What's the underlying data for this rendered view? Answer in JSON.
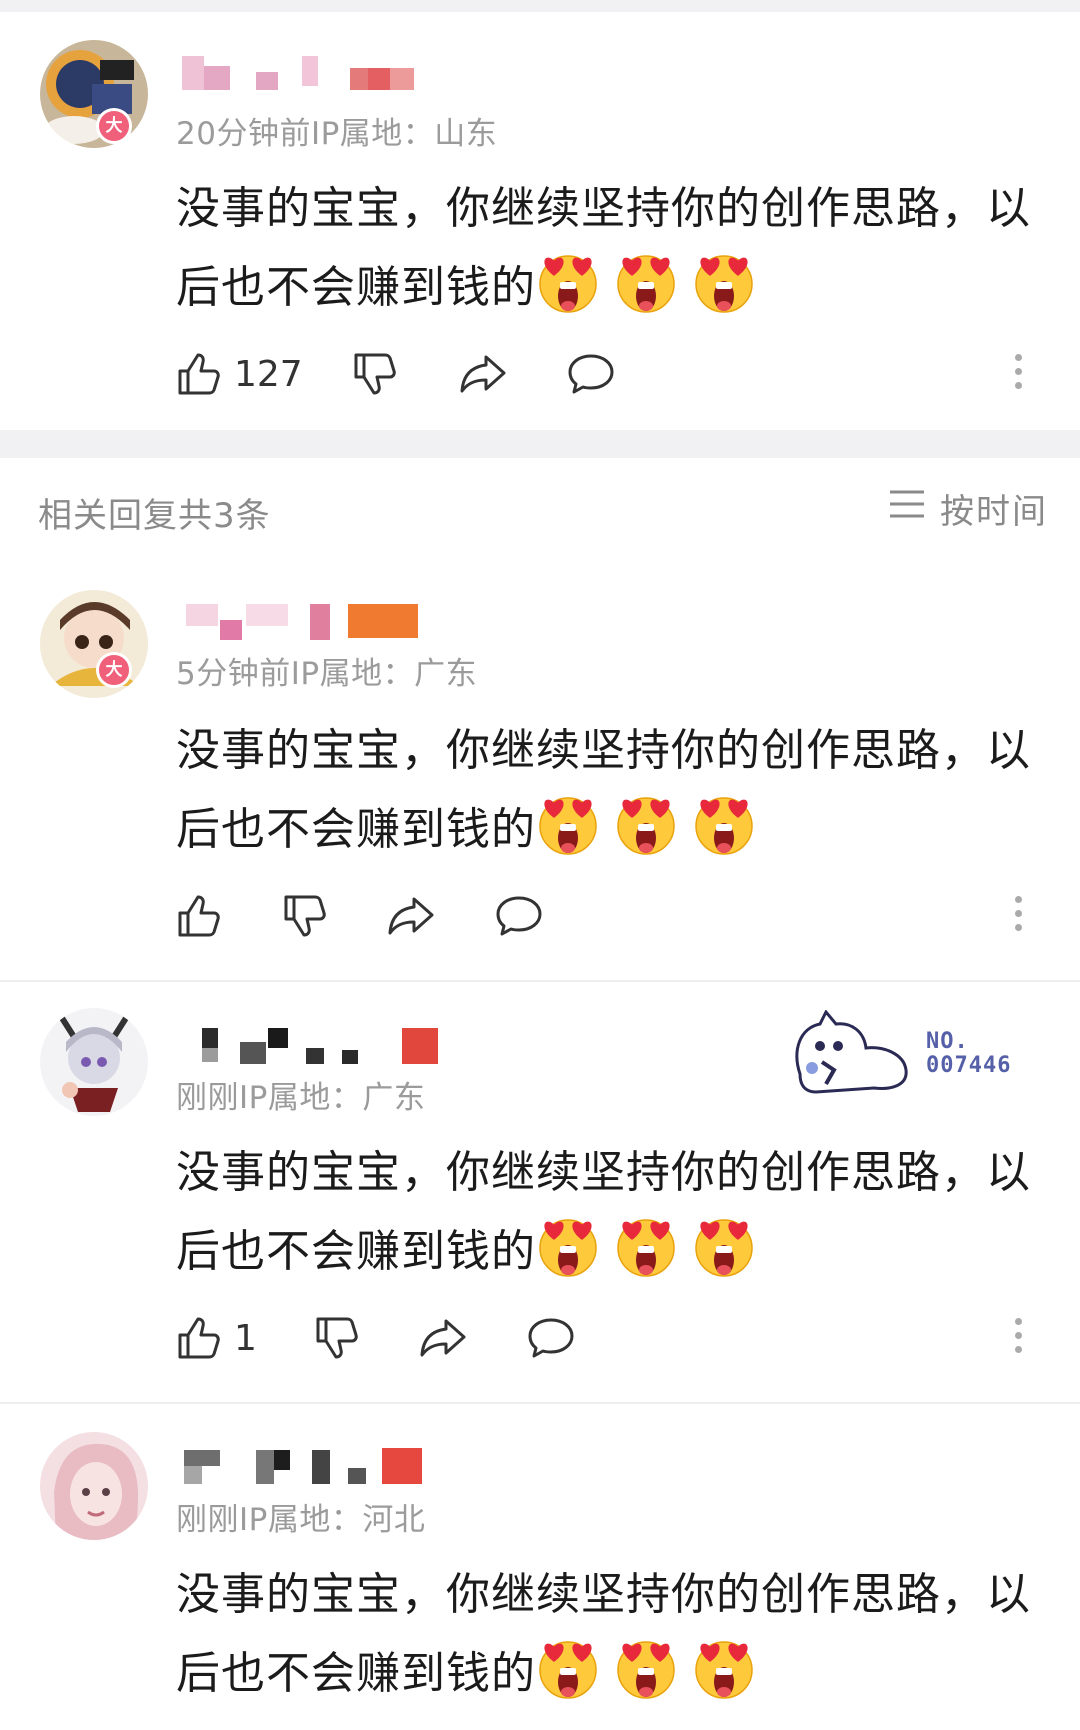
{
  "comments": [
    {
      "id": "main",
      "time": "20分钟前",
      "ip_label": "IP属地：",
      "ip": "山东",
      "text": "没事的宝宝，你继续坚持你的创作思路，以后也不会赚到钱的",
      "emoji": [
        "heart-eyes-emoji",
        "heart-eyes-emoji",
        "heart-eyes-emoji"
      ],
      "likes": "127",
      "avatar_badge": "大"
    },
    {
      "id": "reply1",
      "time": "5分钟前",
      "ip_label": "IP属地：",
      "ip": "广东",
      "text": "没事的宝宝，你继续坚持你的创作思路，以后也不会赚到钱的",
      "emoji": [
        "heart-eyes-emoji",
        "heart-eyes-emoji",
        "heart-eyes-emoji"
      ],
      "likes": "",
      "avatar_badge": "大"
    },
    {
      "id": "reply2",
      "time": "刚刚",
      "ip_label": "IP属地：",
      "ip": "广东",
      "text": "没事的宝宝，你继续坚持你的创作思路，以后也不会赚到钱的",
      "emoji": [
        "heart-eyes-emoji",
        "heart-eyes-emoji",
        "heart-eyes-emoji"
      ],
      "likes": "1",
      "decoration_badge": {
        "label": "NO.",
        "number": "007446"
      }
    },
    {
      "id": "reply3",
      "time": "刚刚",
      "ip_label": "IP属地：",
      "ip": "河北",
      "text": "没事的宝宝，你继续坚持你的创作思路，以后也不会赚到钱的",
      "emoji": [
        "heart-eyes-emoji",
        "heart-eyes-emoji",
        "heart-eyes-emoji"
      ],
      "likes": ""
    }
  ],
  "replies_header": "相关回复共3条",
  "sort": {
    "label": "按时间",
    "icon": "menu-lines-icon"
  },
  "colors": {
    "text": "#1b1b1b",
    "meta": "#9b9b9b",
    "badge": "#f0607a",
    "separator": "#f1f1f3"
  }
}
